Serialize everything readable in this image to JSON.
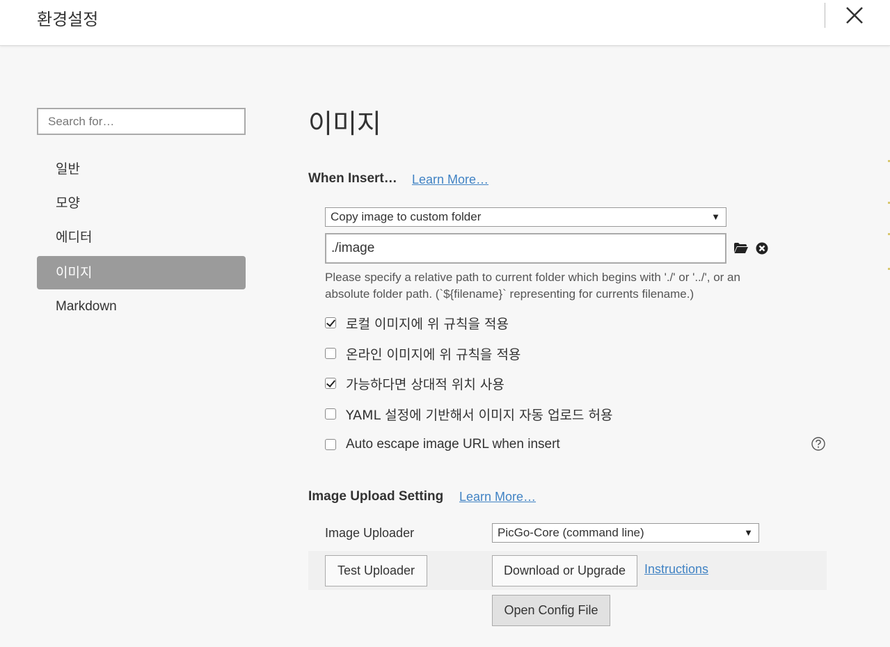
{
  "window": {
    "title": "환경설정"
  },
  "sidebar": {
    "search_placeholder": "Search for…",
    "items": [
      {
        "label": "일반"
      },
      {
        "label": "모양"
      },
      {
        "label": "에디터"
      },
      {
        "label": "이미지",
        "active": true
      },
      {
        "label": "Markdown"
      }
    ]
  },
  "main": {
    "page_title": "이미지",
    "when_insert": {
      "title": "When Insert…",
      "learn_more": "Learn More…",
      "action_select": "Copy image to custom folder",
      "path_value": "./image",
      "hint": "Please specify a relative path to current folder which begins with './' or '../', or an absolute folder path. (`${filename}` representing for currents filename.)",
      "options": [
        {
          "label": "로컬 이미지에 위 규칙을 적용",
          "checked": true
        },
        {
          "label": "온라인 이미지에 위 규칙을 적용",
          "checked": false
        },
        {
          "label": "가능하다면 상대적 위치 사용",
          "checked": true
        },
        {
          "label": "YAML 설정에 기반해서 이미지 자동 업로드 허용",
          "checked": false
        },
        {
          "label": "Auto escape image URL when insert",
          "checked": false
        }
      ]
    },
    "upload": {
      "title": "Image Upload Setting",
      "learn_more": "Learn More…",
      "uploader_label": "Image Uploader",
      "uploader_select": "PicGo-Core (command line)",
      "test_button": "Test Uploader",
      "download_button": "Download or Upgrade",
      "instructions_link": "Instructions",
      "open_config_button": "Open Config File"
    }
  },
  "icons": {
    "close": "close-icon",
    "folder": "folder-icon",
    "clear": "clear-icon",
    "help": "help-icon",
    "dropdown": "chevron-down-icon"
  },
  "colors": {
    "accent_link": "#4183c4",
    "active_nav": "#9b9b9b",
    "background": "#f7f7f7"
  }
}
